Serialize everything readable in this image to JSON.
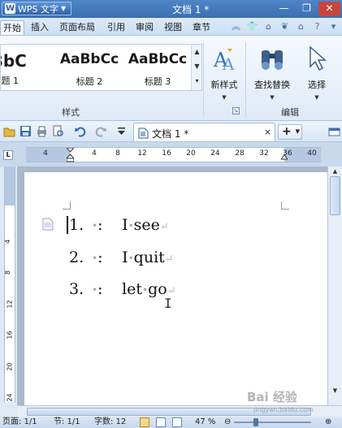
{
  "app": {
    "name": "WPS 文字",
    "window_title": "文档 1 *"
  },
  "menu": {
    "tabs": [
      "开始",
      "插入",
      "页面布局",
      "引用",
      "审阅",
      "视图",
      "章节"
    ]
  },
  "ribbon": {
    "styles": [
      {
        "sample": "aBbC",
        "name": "题 1"
      },
      {
        "sample": "AaBbCc",
        "name": "标题 2"
      },
      {
        "sample": "AaBbCc",
        "name": "标题 3"
      }
    ],
    "styles_group_label": "样式",
    "new_style_label": "新样式",
    "find_replace_label": "查找替换",
    "select_label": "选择",
    "edit_group_label": "编辑"
  },
  "doc_tab": {
    "label": "文档 1 *",
    "close": "×",
    "new_tab": "+"
  },
  "ruler": {
    "corner": "L",
    "numbers": [
      "4",
      "4",
      "8",
      "12",
      "16",
      "20",
      "24",
      "28",
      "32",
      "36",
      "40"
    ],
    "vertical_numbers": [
      "4",
      "8",
      "12",
      "16",
      "20",
      "24"
    ]
  },
  "document": {
    "items": [
      {
        "num": "1.",
        "colon": ":",
        "words": [
          "I",
          "see"
        ]
      },
      {
        "num": "2.",
        "colon": ":",
        "words": [
          "I",
          "quit"
        ]
      },
      {
        "num": "3.",
        "colon": ":",
        "words": [
          "let",
          "go"
        ]
      }
    ]
  },
  "status": {
    "page": "页面: 1/1",
    "section": "节: 1/1",
    "word_count": "字数: 12",
    "zoom": "47 %"
  },
  "watermark": {
    "text": "Bai 经验",
    "url": "jingyan.baidu.com"
  },
  "colors": {
    "titlebar": "#3a6fb3",
    "close_button": "#c9463d",
    "accent": "#4f86c6"
  }
}
